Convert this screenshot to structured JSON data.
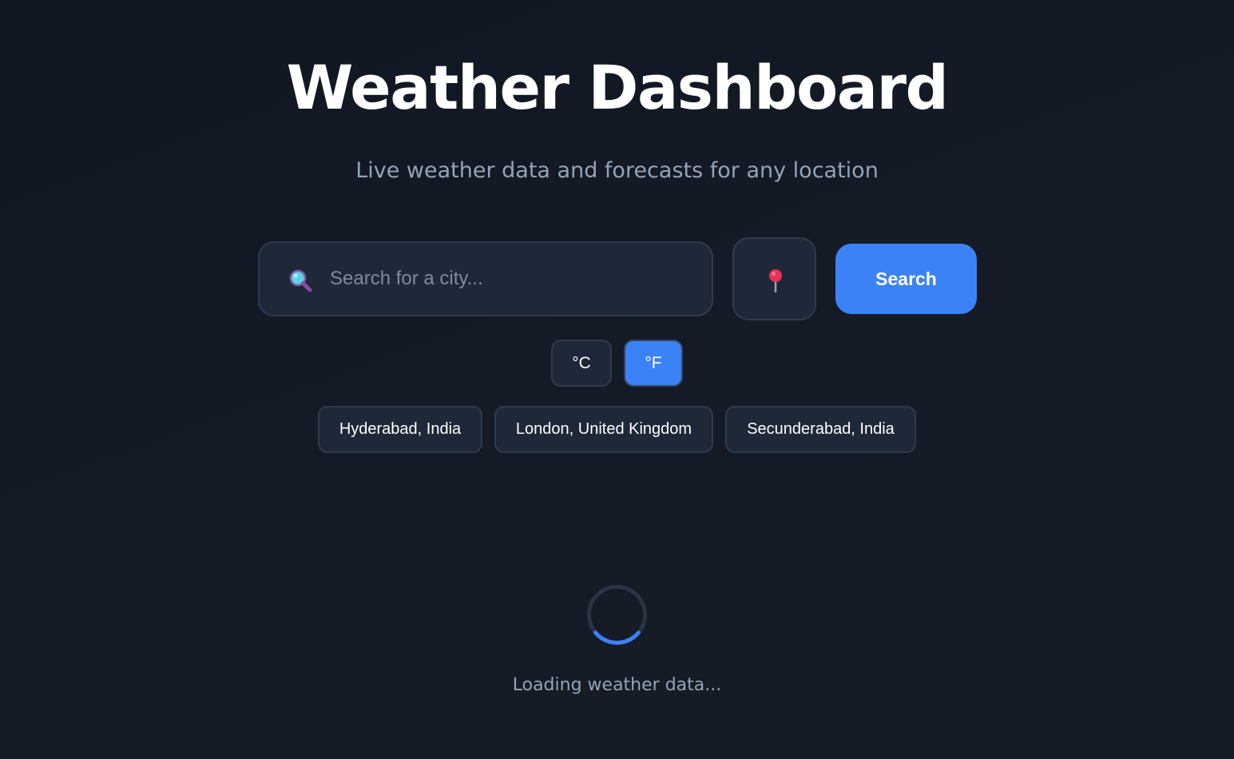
{
  "header": {
    "title": "Weather Dashboard",
    "subtitle": "Live weather data and forecasts for any location"
  },
  "search": {
    "placeholder": "Search for a city...",
    "value": "",
    "search_icon": "magnifying-glass-icon",
    "location_icon": "map-pin-icon",
    "button_label": "Search"
  },
  "units": {
    "celsius_label": "°C",
    "fahrenheit_label": "°F",
    "selected": "°F"
  },
  "recent_cities": [
    "Hyderabad, India",
    "London, United Kingdom",
    "Secunderabad, India"
  ],
  "status": {
    "loading_text": "Loading weather data..."
  },
  "colors": {
    "accent": "#3b82f6",
    "background": "#151b26",
    "card": "#1e2838",
    "muted_text": "#94a3b8"
  }
}
